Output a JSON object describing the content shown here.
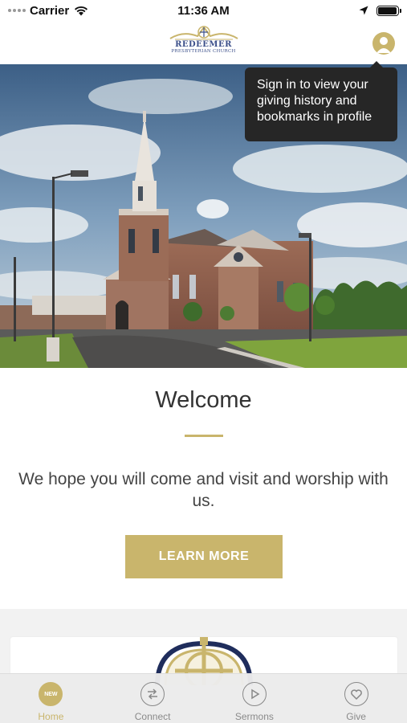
{
  "status_bar": {
    "carrier": "Carrier",
    "time": "11:36 AM",
    "battery_level": 0.95
  },
  "header": {
    "logo": {
      "name": "REDEEMER",
      "subtitle": "PRESBYTERIAN CHURCH"
    },
    "profile_icon": "person-icon"
  },
  "tooltip": {
    "lines": [
      "Sign in to view your",
      "giving history and",
      "bookmarks in profile"
    ]
  },
  "hero": {
    "image_subject": "church-building-photo"
  },
  "welcome": {
    "title": "Welcome",
    "text": "We hope you will come and visit and worship with us.",
    "button_label": "LEARN MORE"
  },
  "tabs": [
    {
      "label": "Home",
      "icon": "new-badge-icon",
      "badge": "NEW",
      "active": true
    },
    {
      "label": "Connect",
      "icon": "swap-arrows-icon",
      "active": false
    },
    {
      "label": "Sermons",
      "icon": "play-icon",
      "active": false
    },
    {
      "label": "Give",
      "icon": "heart-icon",
      "active": false
    }
  ],
  "colors": {
    "accent": "#c9b56c",
    "tooltip_bg": "#262626",
    "logo_blue": "#3b4f8a"
  }
}
